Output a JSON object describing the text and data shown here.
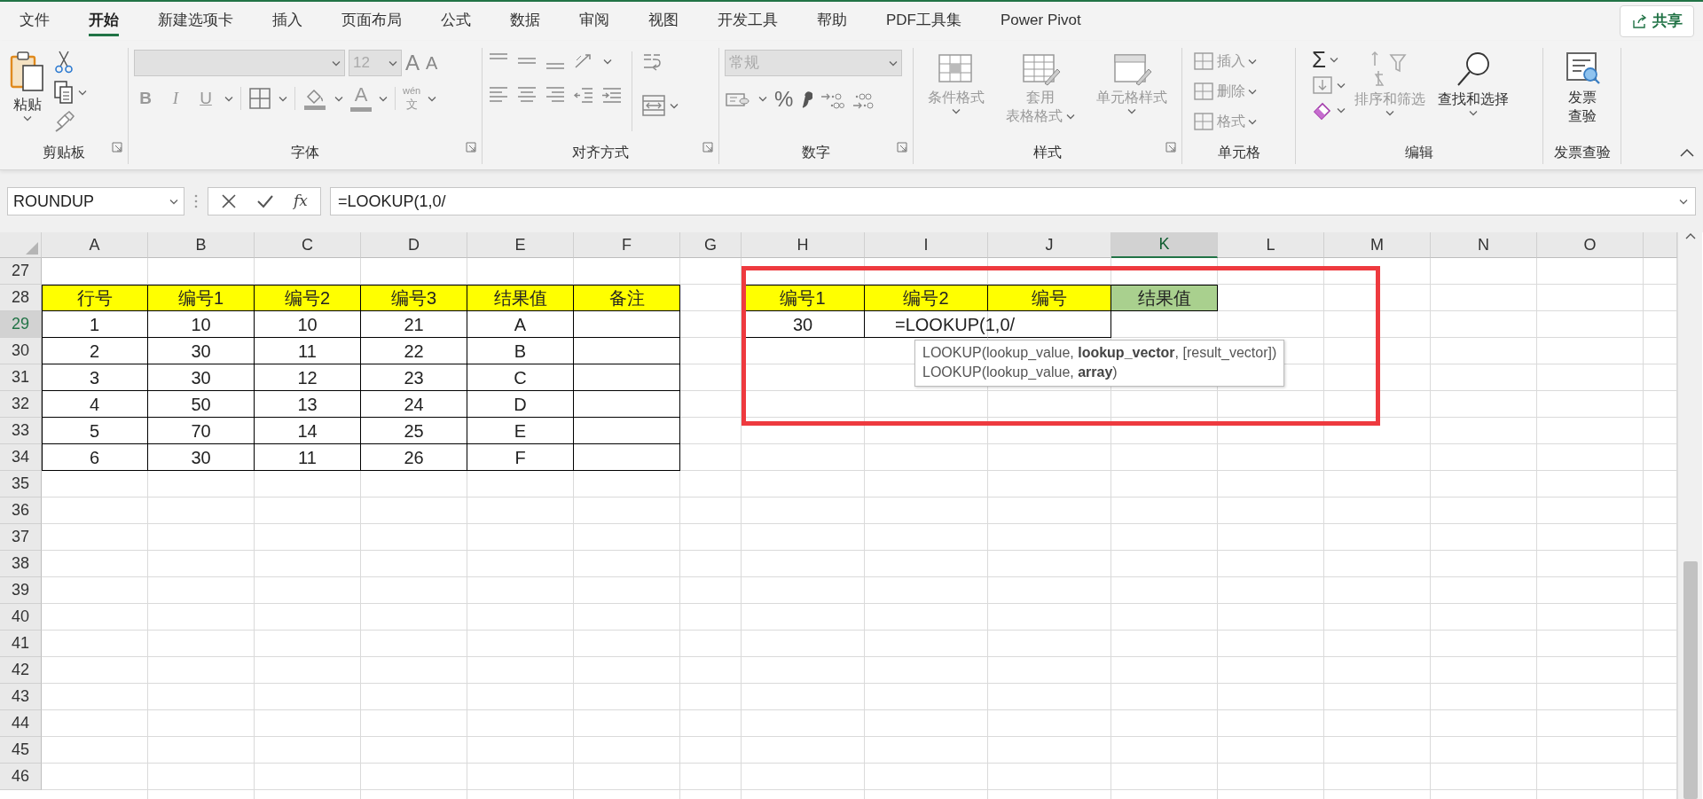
{
  "menu_tabs": [
    {
      "label": "文件",
      "selected": false
    },
    {
      "label": "开始",
      "selected": true
    },
    {
      "label": "新建选项卡",
      "selected": false
    },
    {
      "label": "插入",
      "selected": false
    },
    {
      "label": "页面布局",
      "selected": false
    },
    {
      "label": "公式",
      "selected": false
    },
    {
      "label": "数据",
      "selected": false
    },
    {
      "label": "审阅",
      "selected": false
    },
    {
      "label": "视图",
      "selected": false
    },
    {
      "label": "开发工具",
      "selected": false
    },
    {
      "label": "帮助",
      "selected": false
    },
    {
      "label": "PDF工具集",
      "selected": false
    },
    {
      "label": "Power Pivot",
      "selected": false
    }
  ],
  "share_button": {
    "label": "共享"
  },
  "ribbon": {
    "clipboard": {
      "paste": "粘贴",
      "label": "剪贴板"
    },
    "font": {
      "size": "12",
      "grow": "A",
      "shrink": "A",
      "format_buttons": [
        "B",
        "I",
        "U"
      ],
      "font_color": "A",
      "phonetic": [
        "wén",
        "文"
      ],
      "label": "字体"
    },
    "alignment": {
      "label": "对齐方式"
    },
    "number": {
      "format": "常规",
      "percent": "%",
      "label": "数字"
    },
    "styles": {
      "buttons": [
        {
          "lines": [
            "条件格式"
          ],
          "disabled": true
        },
        {
          "lines": [
            "套用",
            "表格格式"
          ],
          "disabled": true
        },
        {
          "lines": [
            "单元格样式"
          ],
          "disabled": true
        }
      ],
      "label": "样式"
    },
    "cells": {
      "buttons": [
        {
          "label": "插入",
          "disabled": true
        },
        {
          "label": "删除",
          "disabled": true
        },
        {
          "label": "格式",
          "disabled": true
        }
      ],
      "label": "单元格"
    },
    "editing": {
      "sigma": "Σ",
      "buttons": [
        {
          "lines": [
            "排序和筛选"
          ],
          "disabled": true
        },
        {
          "lines": [
            "查找和选择"
          ],
          "disabled": false
        }
      ],
      "label": "编辑"
    },
    "invoice": {
      "button": [
        "发票",
        "查验"
      ],
      "label": "发票查验"
    }
  },
  "formula_bar": {
    "name_box": "ROUNDUP",
    "fx": "fx",
    "value": "=LOOKUP(1,0/"
  },
  "sheet": {
    "columns": [
      {
        "label": "A",
        "selected": false
      },
      {
        "label": "B",
        "selected": false
      },
      {
        "label": "C",
        "selected": false
      },
      {
        "label": "D",
        "selected": false
      },
      {
        "label": "E",
        "selected": false
      },
      {
        "label": "F",
        "selected": false
      },
      {
        "label": "G",
        "selected": false
      },
      {
        "label": "H",
        "selected": false
      },
      {
        "label": "I",
        "selected": false
      },
      {
        "label": "J",
        "selected": false
      },
      {
        "label": "K",
        "selected": true
      },
      {
        "label": "L",
        "selected": false
      },
      {
        "label": "M",
        "selected": false
      },
      {
        "label": "N",
        "selected": false
      },
      {
        "label": "O",
        "selected": false
      }
    ],
    "rows": [
      {
        "label": "27",
        "selected": false
      },
      {
        "label": "28",
        "selected": false
      },
      {
        "label": "29",
        "selected": true
      },
      {
        "label": "30",
        "selected": false
      },
      {
        "label": "31",
        "selected": false
      },
      {
        "label": "32",
        "selected": false
      },
      {
        "label": "33",
        "selected": false
      },
      {
        "label": "34",
        "selected": false
      },
      {
        "label": "35",
        "selected": false
      },
      {
        "label": "36",
        "selected": false
      },
      {
        "label": "37",
        "selected": false
      },
      {
        "label": "38",
        "selected": false
      },
      {
        "label": "39",
        "selected": false
      },
      {
        "label": "40",
        "selected": false
      },
      {
        "label": "41",
        "selected": false
      },
      {
        "label": "42",
        "selected": false
      },
      {
        "label": "43",
        "selected": false
      },
      {
        "label": "44",
        "selected": false
      },
      {
        "label": "45",
        "selected": false
      },
      {
        "label": "46",
        "selected": false
      }
    ],
    "tables": [
      {
        "header": [
          {
            "text": "行号",
            "color": "#ffff00"
          },
          {
            "text": "编号1",
            "color": "#ffff00"
          },
          {
            "text": "编号2",
            "color": "#ffff00"
          },
          {
            "text": "编号3",
            "color": "#ffff00"
          },
          {
            "text": "结果值",
            "color": "#ffff00"
          },
          {
            "text": "备注",
            "color": "#ffff00"
          }
        ],
        "rows": [
          [
            "1",
            "10",
            "10",
            "21",
            "A",
            null
          ],
          [
            "2",
            "30",
            "11",
            "22",
            "B",
            null
          ],
          [
            "3",
            "30",
            "12",
            "23",
            "C",
            null
          ],
          [
            "4",
            "50",
            "13",
            "24",
            "D",
            null
          ],
          [
            "5",
            "70",
            "14",
            "25",
            "E",
            null
          ],
          [
            "6",
            "30",
            "11",
            "26",
            "F",
            null
          ]
        ]
      },
      {
        "header": [
          {
            "text": "编号1",
            "color": "#ffff00"
          },
          {
            "text": "编号2",
            "color": "#ffff00"
          },
          {
            "text": "编号",
            "color": "#ffff00"
          },
          {
            "text": "结果值",
            "color": "#a9d08e"
          }
        ],
        "rows": [
          [
            "30",
            "=LOOKUP(1,0/",
            null
          ]
        ]
      }
    ],
    "tooltip": {
      "lines": [
        "LOOKUP(lookup_value, **lookup_vector**, [result_vector])",
        "LOOKUP(lookup_value, **array**)"
      ]
    }
  }
}
